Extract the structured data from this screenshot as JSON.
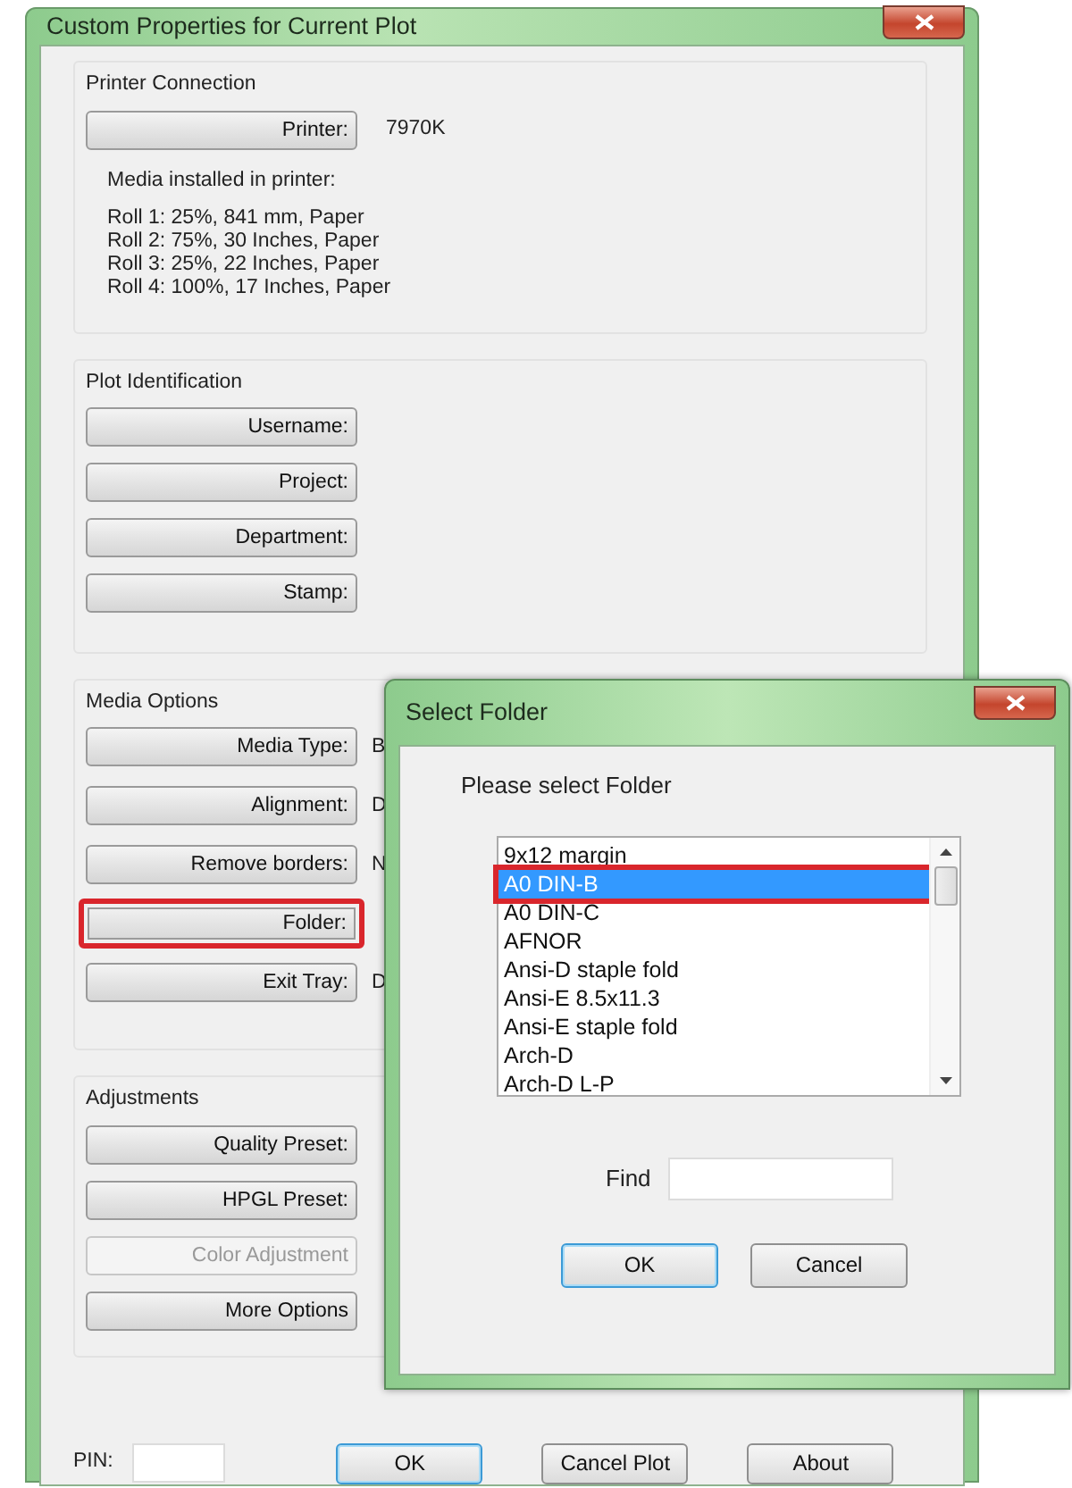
{
  "window": {
    "title": "Custom Properties for Current Plot"
  },
  "printer_connection": {
    "title": "Printer Connection",
    "button": "Printer:",
    "value": "7970K",
    "media_heading": "Media installed in  printer:",
    "rolls": [
      "Roll 1: 25%, 841 mm, Paper",
      "Roll 2: 75%, 30 Inches, Paper",
      "Roll 3: 25%, 22 Inches, Paper",
      "Roll 4: 100%, 17 Inches, Paper"
    ]
  },
  "plot_identification": {
    "title": "Plot Identification",
    "buttons": [
      "Username:",
      "Project:",
      "Department:",
      "Stamp:"
    ]
  },
  "media_options": {
    "title": "Media Options",
    "rows": [
      {
        "button": "Media Type:",
        "value": "B",
        "highlighted": false
      },
      {
        "button": "Alignment:",
        "value": "D",
        "highlighted": false
      },
      {
        "button": "Remove borders:",
        "value": "N",
        "highlighted": false
      },
      {
        "button": "Folder:",
        "highlighted": true
      },
      {
        "button": "Exit Tray:",
        "value": "D",
        "highlighted": false
      }
    ]
  },
  "adjustments": {
    "title": "Adjustments",
    "buttons": [
      {
        "label": "Quality Preset:",
        "disabled": false
      },
      {
        "label": "HPGL Preset:",
        "disabled": false
      },
      {
        "label": "Color Adjustment",
        "disabled": true
      },
      {
        "label": "More Options",
        "disabled": false
      }
    ]
  },
  "pin": {
    "label": "PIN:"
  },
  "buttons": [
    {
      "label": "OK",
      "default": true
    },
    {
      "label": "Cancel Plot",
      "default": false
    },
    {
      "label": "About",
      "default": false
    }
  ],
  "select_folder": {
    "title": "Select Folder",
    "prompt": "Please select Folder",
    "items": [
      {
        "label": "9x12 margin",
        "selected": false,
        "highlighted": false
      },
      {
        "label": "A0 DIN-B",
        "selected": true,
        "highlighted": true
      },
      {
        "label": "A0 DIN-C",
        "selected": false,
        "highlighted": false
      },
      {
        "label": "AFNOR",
        "selected": false,
        "highlighted": false
      },
      {
        "label": "Ansi-D staple fold",
        "selected": false,
        "highlighted": false
      },
      {
        "label": "Ansi-E 8.5x11.3",
        "selected": false,
        "highlighted": false
      },
      {
        "label": "Ansi-E staple fold",
        "selected": false,
        "highlighted": false
      },
      {
        "label": "Arch-D",
        "selected": false,
        "highlighted": false
      },
      {
        "label": "Arch-D L-P",
        "selected": false,
        "highlighted": false
      }
    ],
    "find_label": "Find",
    "buttons": [
      {
        "label": "OK",
        "default": true
      },
      {
        "label": "Cancel",
        "default": false
      }
    ]
  }
}
